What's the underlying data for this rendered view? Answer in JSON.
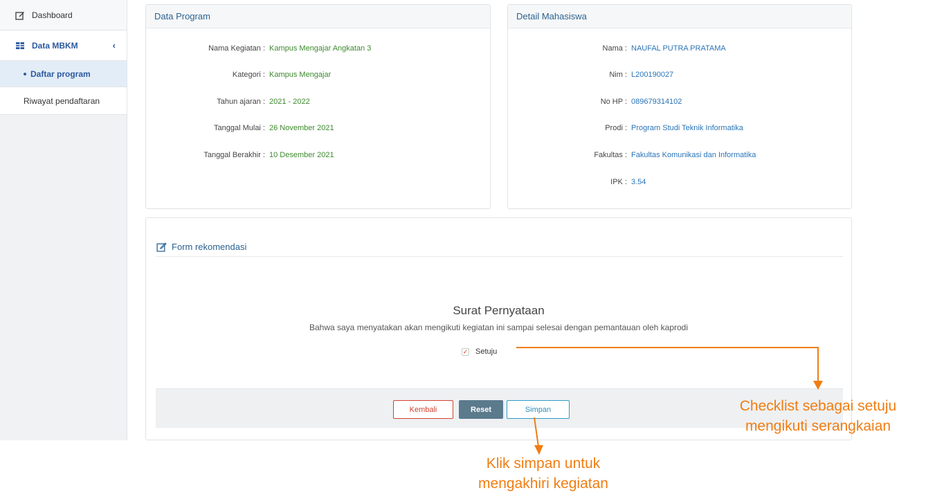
{
  "sidebar": {
    "dashboard": "Dashboard",
    "data_mbkm": "Data MBKM",
    "daftar_program": "Daftar program",
    "riwayat": "Riwayat pendaftaran"
  },
  "data_program": {
    "title": "Data Program",
    "rows": [
      {
        "label": "Nama Kegiatan :",
        "value": "Kampus Mengajar Angkatan 3"
      },
      {
        "label": "Kategori :",
        "value": "Kampus Mengajar"
      },
      {
        "label": "Tahun ajaran :",
        "value": "2021 - 2022"
      },
      {
        "label": "Tanggal Mulai :",
        "value": "26 November 2021"
      },
      {
        "label": "Tanggal Berakhir :",
        "value": "10 Desember 2021"
      }
    ]
  },
  "detail_mahasiswa": {
    "title": "Detail Mahasiswa",
    "rows": [
      {
        "label": "Nama :",
        "value": "NAUFAL PUTRA PRATAMA"
      },
      {
        "label": "Nim :",
        "value": "L200190027"
      },
      {
        "label": "No HP :",
        "value": "089679314102"
      },
      {
        "label": "Prodi :",
        "value": "Program Studi Teknik Informatika"
      },
      {
        "label": "Fakultas :",
        "value": "Fakultas Komunikasi dan Informatika"
      },
      {
        "label": "IPK :",
        "value": "3.54"
      }
    ]
  },
  "form": {
    "title": "Form rekomendasi",
    "surat_title": "Surat Pernyataan",
    "surat_text": "Bahwa saya menyatakan akan mengikuti kegiatan ini sampai selesai dengan pemantauan oleh kaprodi",
    "checkbox_label": "Setuju",
    "checkbox_checked": true,
    "buttons": {
      "kembali": "Kembali",
      "reset": "Reset",
      "simpan": "Simpan"
    }
  },
  "annotations": {
    "checklist_line1": "Checklist sebagai setuju",
    "checklist_line2": "mengikuti serangkaian",
    "simpan_line1": "Klik simpan untuk",
    "simpan_line2": "mengakhiri kegiatan"
  },
  "colors": {
    "accent": "#2c5aa0",
    "annotation": "#f07d12",
    "value_green": "#3d8a2e",
    "value_blue": "#2a74b8"
  },
  "icons": [
    "edit-icon",
    "grid-icon",
    "chevron-left-icon",
    "bullet-icon",
    "checkmark-icon"
  ]
}
